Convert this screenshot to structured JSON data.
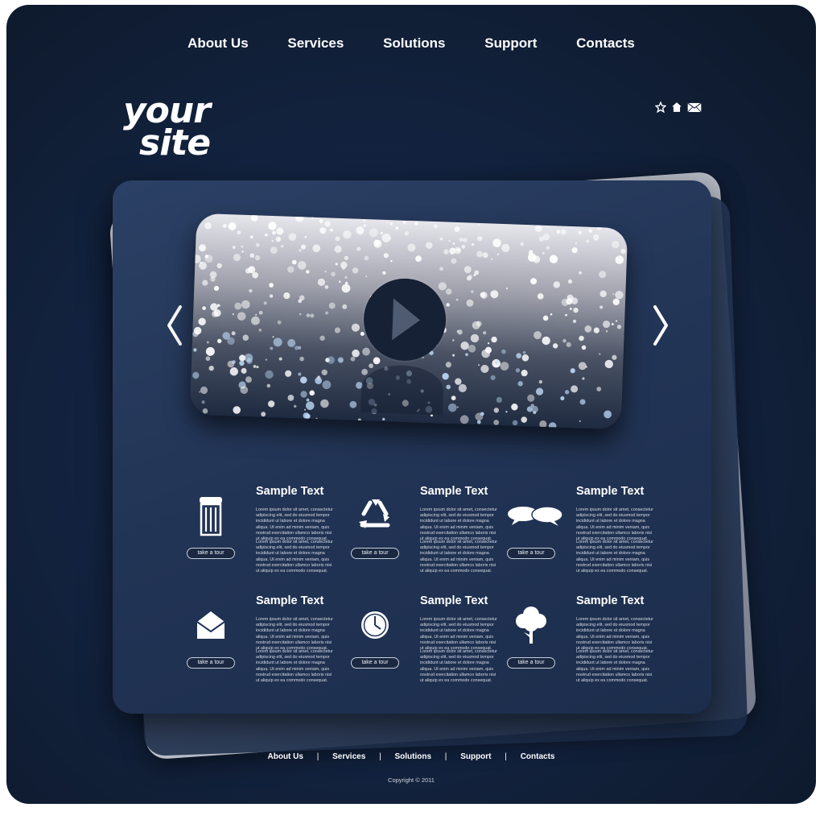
{
  "nav": {
    "items": [
      "About Us",
      "Services",
      "Solutions",
      "Support",
      "Contacts"
    ]
  },
  "logo": {
    "line1": "your",
    "line2": "site"
  },
  "header_icons": [
    "star-icon",
    "home-icon",
    "mail-icon"
  ],
  "slider": {
    "prev_icon": "chevron-left-icon",
    "next_icon": "chevron-right-icon",
    "play_icon": "play-icon"
  },
  "features": [
    {
      "icon": "trash-icon",
      "title": "Sample Text",
      "para1": "Lorem ipsum dolor sit amet, consectetur adipiscing elit, sed do eiusmod tempor incididunt ut labore et dolore magna aliqua. Ut enim ad minim veniam, quis nostrud exercitation ullamco laboris nisi ut aliquip ex ea commodo consequat.",
      "para2": "Lorem ipsum dolor sit amet, consectetur adipiscing elit, sed do eiusmod tempor incididunt ut labore et dolore magna aliqua. Ut enim ad minim veniam, quis nostrud exercitation ullamco laboris nisi ut aliquip ex ea commodo consequat.",
      "button": "take a tour"
    },
    {
      "icon": "recycle-icon",
      "title": "Sample Text",
      "para1": "Lorem ipsum dolor sit amet, consectetur adipiscing elit, sed do eiusmod tempor incididunt ut labore et dolore magna aliqua. Ut enim ad minim veniam, quis nostrud exercitation ullamco laboris nisi ut aliquip ex ea commodo consequat.",
      "para2": "Lorem ipsum dolor sit amet, consectetur adipiscing elit, sed do eiusmod tempor incididunt ut labore et dolore magna aliqua. Ut enim ad minim veniam, quis nostrud exercitation ullamco laboris nisi ut aliquip ex ea commodo consequat.",
      "button": "take a tour"
    },
    {
      "icon": "chat-bubbles-icon",
      "title": "Sample Text",
      "para1": "Lorem ipsum dolor sit amet, consectetur adipiscing elit, sed do eiusmod tempor incididunt ut labore et dolore magna aliqua. Ut enim ad minim veniam, quis nostrud exercitation ullamco laboris nisi ut aliquip ex ea commodo consequat.",
      "para2": "Lorem ipsum dolor sit amet, consectetur adipiscing elit, sed do eiusmod tempor incididunt ut labore et dolore magna aliqua. Ut enim ad minim veniam, quis nostrud exercitation ullamco laboris nisi ut aliquip ex ea commodo consequat.",
      "button": "take a tour"
    },
    {
      "icon": "envelope-icon",
      "title": "Sample Text",
      "para1": "Lorem ipsum dolor sit amet, consectetur adipiscing elit, sed do eiusmod tempor incididunt ut labore et dolore magna aliqua. Ut enim ad minim veniam, quis nostrud exercitation ullamco laboris nisi ut aliquip ex ea commodo consequat.",
      "para2": "Lorem ipsum dolor sit amet, consectetur adipiscing elit, sed do eiusmod tempor incididunt ut labore et dolore magna aliqua. Ut enim ad minim veniam, quis nostrud exercitation ullamco laboris nisi ut aliquip ex ea commodo consequat.",
      "button": "take a tour"
    },
    {
      "icon": "clock-icon",
      "title": "Sample Text",
      "para1": "Lorem ipsum dolor sit amet, consectetur adipiscing elit, sed do eiusmod tempor incididunt ut labore et dolore magna aliqua. Ut enim ad minim veniam, quis nostrud exercitation ullamco laboris nisi ut aliquip ex ea commodo consequat.",
      "para2": "Lorem ipsum dolor sit amet, consectetur adipiscing elit, sed do eiusmod tempor incididunt ut labore et dolore magna aliqua. Ut enim ad minim veniam, quis nostrud exercitation ullamco laboris nisi ut aliquip ex ea commodo consequat.",
      "button": "take a tour"
    },
    {
      "icon": "tree-icon",
      "title": "Sample Text",
      "para1": "Lorem ipsum dolor sit amet, consectetur adipiscing elit, sed do eiusmod tempor incididunt ut labore et dolore magna aliqua. Ut enim ad minim veniam, quis nostrud exercitation ullamco laboris nisi ut aliquip ex ea commodo consequat.",
      "para2": "Lorem ipsum dolor sit amet, consectetur adipiscing elit, sed do eiusmod tempor incididunt ut labore et dolore magna aliqua. Ut enim ad minim veniam, quis nostrud exercitation ullamco laboris nisi ut aliquip ex ea commodo consequat.",
      "button": "take a tour"
    }
  ],
  "footer": {
    "items": [
      "About Us",
      "Services",
      "Solutions",
      "Support",
      "Contacts"
    ],
    "separator": "|",
    "copyright": "Copyright © 2011"
  },
  "colors": {
    "background": "#132340",
    "card": "#223455",
    "text": "#ffffff",
    "button_border": "#c9cfda"
  }
}
